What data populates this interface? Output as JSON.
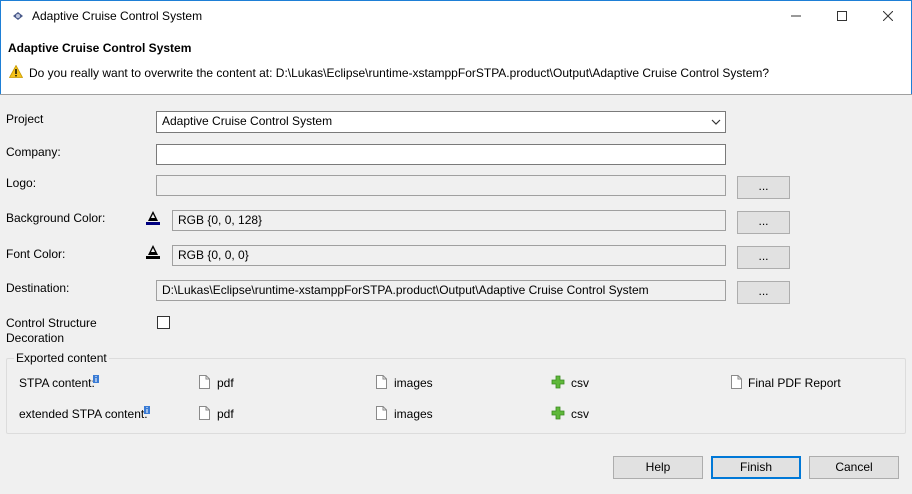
{
  "window": {
    "title": "Adaptive Cruise Control System"
  },
  "header": {
    "title": "Adaptive Cruise Control System",
    "message": "Do you really want to overwrite the content at: D:\\Lukas\\Eclipse\\runtime-xstamppForSTPA.product\\Output\\Adaptive Cruise Control System?"
  },
  "form": {
    "project_label": "Project",
    "project_value": "Adaptive Cruise Control System",
    "company_label": "Company:",
    "company_value": "",
    "logo_label": "Logo:",
    "logo_value": "",
    "bg_color_label": "Background Color:",
    "bg_color_value": "RGB {0, 0, 128}",
    "font_color_label": "Font Color:",
    "font_color_value": "RGB {0, 0, 0}",
    "destination_label": "Destination:",
    "destination_value": "D:\\Lukas\\Eclipse\\runtime-xstamppForSTPA.product\\Output\\Adaptive Cruise Control System",
    "decoration_label_1": "Control Structure",
    "decoration_label_2": "Decoration",
    "decoration_checked": false,
    "browse_label": "..."
  },
  "exported": {
    "title": "Exported content",
    "rows": [
      {
        "label": "STPA content:",
        "items": [
          "pdf",
          "images",
          "csv",
          "Final PDF Report"
        ]
      },
      {
        "label": "extended STPA content:",
        "items": [
          "pdf",
          "images",
          "csv"
        ]
      }
    ]
  },
  "footer": {
    "help": "Help",
    "finish": "Finish",
    "cancel": "Cancel"
  },
  "colors": {
    "accent": "#0078d7",
    "bg_color_swatch": "#000080",
    "font_color_swatch": "#000000"
  }
}
